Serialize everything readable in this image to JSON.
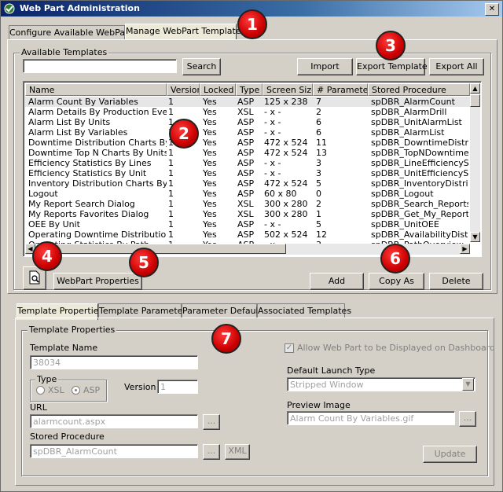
{
  "window": {
    "title": "Web Part Administration",
    "close_symbol": "✕"
  },
  "top_tabs": [
    {
      "label": "Configure Available WebParts"
    },
    {
      "label": "Manage WebPart Templates"
    }
  ],
  "available": {
    "group_label": "Available Templates",
    "search_value": "",
    "search_label": "Search",
    "import_label": "Import",
    "export_label": "Export Template",
    "export_all_label": "Export All"
  },
  "table": {
    "headers": [
      "Name",
      "Version",
      "Locked",
      "Type",
      "Screen Size",
      "# Parameters",
      "Stored Procedure"
    ],
    "rows": [
      [
        "Alarm Count By Variables",
        "1",
        "Yes",
        "ASP",
        "125 x 238",
        "7",
        "spDBR_AlarmCount"
      ],
      [
        "Alarm Details By Production Event",
        "1",
        "Yes",
        "XSL",
        "- x -",
        "2",
        "spDBR_AlarmDrill"
      ],
      [
        "Alarm List By Units",
        "1",
        "Yes",
        "ASP",
        "- x -",
        "6",
        "spDBR_UnitAlarmList"
      ],
      [
        "Alarm List By Variables",
        "1",
        "Yes",
        "ASP",
        "- x -",
        "6",
        "spDBR_AlarmList"
      ],
      [
        "Downtime Distribution Charts By Units",
        "1",
        "Yes",
        "ASP",
        "472 x 524",
        "11",
        "spDBR_DowntimeDistributio"
      ],
      [
        "Downtime Top N Charts By Units",
        "1",
        "Yes",
        "ASP",
        "472 x 524",
        "13",
        "spDBR_TopNDowntime"
      ],
      [
        "Efficiency Statistics By Lines",
        "1",
        "Yes",
        "ASP",
        "- x -",
        "3",
        "spDBR_LineEfficiencyStatis"
      ],
      [
        "Efficiency Statistics By Unit",
        "1",
        "Yes",
        "ASP",
        "- x -",
        "3",
        "spDBR_UnitEfficiencyStatis"
      ],
      [
        "Inventory Distribution Charts By Units",
        "1",
        "Yes",
        "ASP",
        "472 x 524",
        "5",
        "spDBR_InventoryDistribution"
      ],
      [
        "Logout",
        "1",
        "Yes",
        "ASP",
        "60 x 80",
        "0",
        "spDBR_Logout"
      ],
      [
        "My Report Search Dialog",
        "1",
        "Yes",
        "XSL",
        "300 x 280",
        "2",
        "spDBR_Search_Reports"
      ],
      [
        "My Reports Favorites Dialog",
        "1",
        "Yes",
        "XSL",
        "300 x 280",
        "1",
        "spDBR_Get_My_Reports"
      ],
      [
        "OEE By Unit",
        "1",
        "Yes",
        "ASP",
        "- x -",
        "5",
        "spDBR_UnitOEE"
      ],
      [
        "Operating Downtime Distribution",
        "1",
        "Yes",
        "ASP",
        "502 x 524",
        "12",
        "spDBR_AvailabilityDistributio"
      ],
      [
        "Operating Statistics By Path",
        "1",
        "Yes",
        "ASP",
        "- x -",
        "3",
        "spDBR_PathOverview"
      ]
    ],
    "scroll_up": "▲",
    "scroll_down": "▼",
    "scroll_left": "◀",
    "scroll_right": "▶"
  },
  "actions": {
    "webpart_properties_label": "WebPart Properties",
    "add_label": "Add",
    "copy_as_label": "Copy As",
    "delete_label": "Delete"
  },
  "bottom_tabs": [
    {
      "label": "Template Properties"
    },
    {
      "label": "Template Parameters"
    },
    {
      "label": "Parameter Defaults"
    },
    {
      "label": "Associated Templates"
    }
  ],
  "props": {
    "group_label": "Template Properties",
    "template_name_label": "Template Name",
    "template_name_value": "38034",
    "type_label": "Type",
    "xsl_label": "XSL",
    "asp_label": "ASP",
    "version_label": "Version",
    "version_value": "1",
    "url_label": "URL",
    "url_value": "alarmcount.aspx",
    "browse_label": "...",
    "sp_label": "Stored Procedure",
    "sp_value": "spDBR_AlarmCount",
    "xml_label": "XML",
    "allow_label": "Allow Web Part to be Displayed on Dashboard",
    "check_mark": "✓",
    "launch_label": "Default Launch Type",
    "launch_value": "Stripped Window",
    "preview_label": "Preview Image",
    "preview_value": "Alarm Count By Variables.gif",
    "update_label": "Update"
  },
  "callouts": [
    "1",
    "2",
    "3",
    "4",
    "5",
    "6",
    "7"
  ]
}
